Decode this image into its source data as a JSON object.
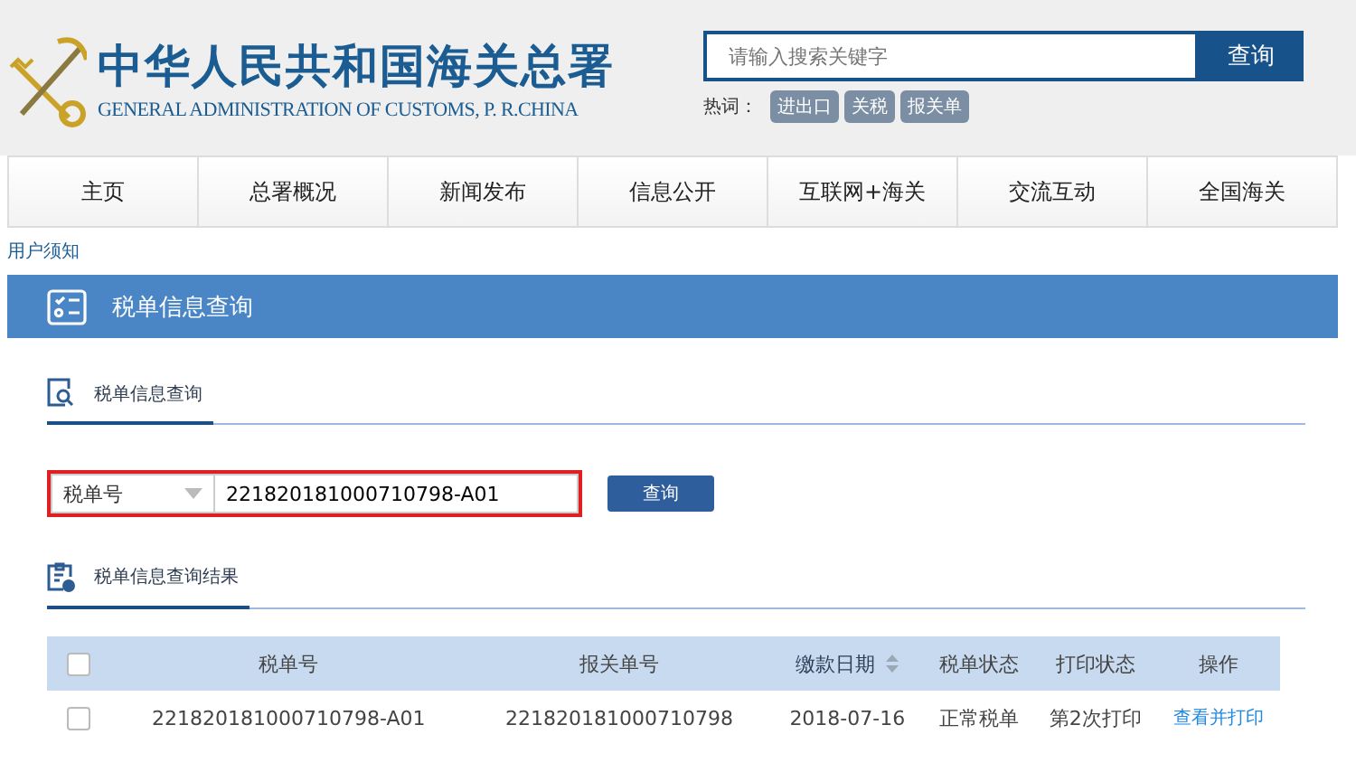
{
  "header": {
    "title": "中华人民共和国海关总署",
    "subtitle": "GENERAL ADMINISTRATION OF CUSTOMS, P. R.CHINA",
    "search": {
      "placeholder": "请输入搜索关键字",
      "button": "查询"
    },
    "hot_label": "热词：",
    "hot_words": [
      "进出口",
      "关税",
      "报关单"
    ]
  },
  "nav": [
    "主页",
    "总署概况",
    "新闻发布",
    "信息公开",
    "互联网+海关",
    "交流互动",
    "全国海关"
  ],
  "breadcrumb": "用户须知",
  "banner": "税单信息查询",
  "query_tab": "税单信息查询",
  "query": {
    "type": "税单号",
    "value": "221820181000710798-A01",
    "button": "查询"
  },
  "result_tab": "税单信息查询结果",
  "table": {
    "header_checked": false,
    "columns": [
      {
        "label": "税单号",
        "sortable": false
      },
      {
        "label": "报关单号",
        "sortable": false
      },
      {
        "label": "缴款日期",
        "sortable": true
      },
      {
        "label": "税单状态",
        "sortable": false
      },
      {
        "label": "打印状态",
        "sortable": false
      },
      {
        "label": "操作",
        "sortable": false
      }
    ],
    "rows": [
      {
        "checked": false,
        "cells": [
          "221820181000710798-A01",
          "221820181000710798",
          "2018-07-16",
          "正常税单",
          "第2次打印"
        ],
        "action": "查看并打印"
      }
    ]
  }
}
